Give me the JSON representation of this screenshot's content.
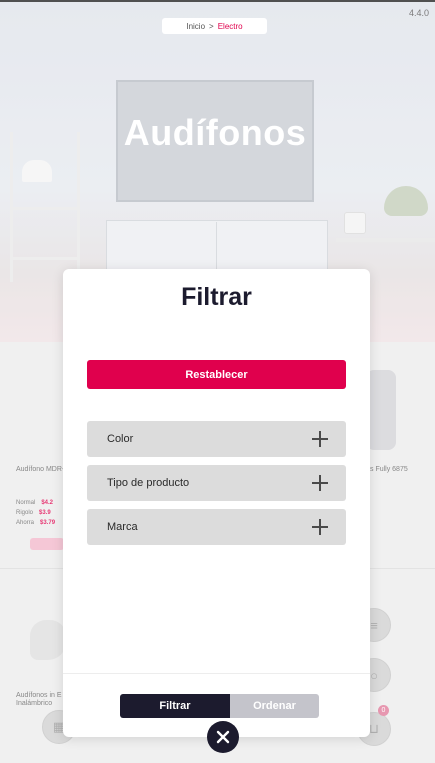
{
  "app": {
    "version": "4.4.0"
  },
  "breadcrumb": {
    "home": "Inicio",
    "separator": ">",
    "current": "Electro"
  },
  "hero": {
    "title": "Audífonos"
  },
  "filter_modal": {
    "title": "Filtrar",
    "reset_label": "Restablecer",
    "sections": [
      {
        "label": "Color",
        "icon": "plus-icon"
      },
      {
        "label": "Tipo de producto",
        "icon": "plus-icon"
      },
      {
        "label": "Marca",
        "icon": "plus-icon"
      }
    ],
    "tabs": {
      "filter_label": "Filtrar",
      "sort_label": "Ordenar",
      "active": "Filtrar"
    },
    "close_icon": "close-icon"
  },
  "background_products": {
    "item1_name": "Audífono MDR-",
    "item1_prices": [
      {
        "label": "Normal",
        "value": "$4.2"
      },
      {
        "label": "Rigolo",
        "value": "$3.9"
      },
      {
        "label": "Ahorra",
        "value": "$3.79"
      }
    ],
    "item2_name": "s Fully 6875",
    "item3_name_line1": "Audífonos in E",
    "item3_name_line2": "Inalámbrico",
    "cart_count": "0"
  },
  "colors": {
    "accent": "#e0004d",
    "dark": "#1c1b2e",
    "accordion_bg": "#dcdcdc",
    "inactive_tab": "#c4c4cb"
  }
}
